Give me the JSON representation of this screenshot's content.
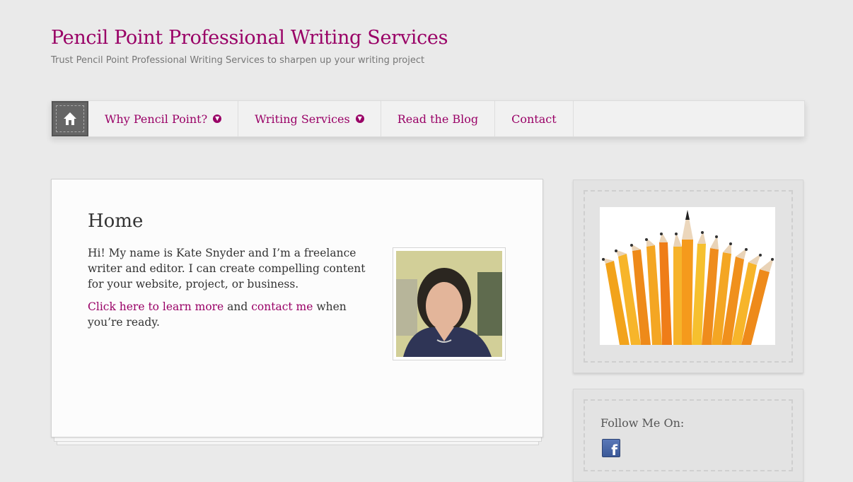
{
  "site": {
    "title": "Pencil Point Professional Writing Services",
    "tagline": "Trust Pencil Point Professional Writing Services to sharpen up your writing project"
  },
  "nav": {
    "home_icon": "home-icon",
    "items": [
      {
        "label": "Why Pencil Point?",
        "has_dropdown": true
      },
      {
        "label": "Writing Services",
        "has_dropdown": true
      },
      {
        "label": "Read the Blog",
        "has_dropdown": false
      },
      {
        "label": "Contact",
        "has_dropdown": false
      }
    ]
  },
  "main": {
    "title": "Home",
    "intro": "Hi! My name is Kate Snyder and I’m a freelance writer and editor. I can create compelling content for your website, project, or business.",
    "link1": "Click here to learn more",
    "connector": " and ",
    "link2": "contact me",
    "tail": " when you’re ready."
  },
  "sidebar": {
    "follow_title": "Follow Me On:",
    "social_icon": "facebook-icon"
  },
  "colors": {
    "accent": "#990066",
    "background": "#eaeaea"
  }
}
